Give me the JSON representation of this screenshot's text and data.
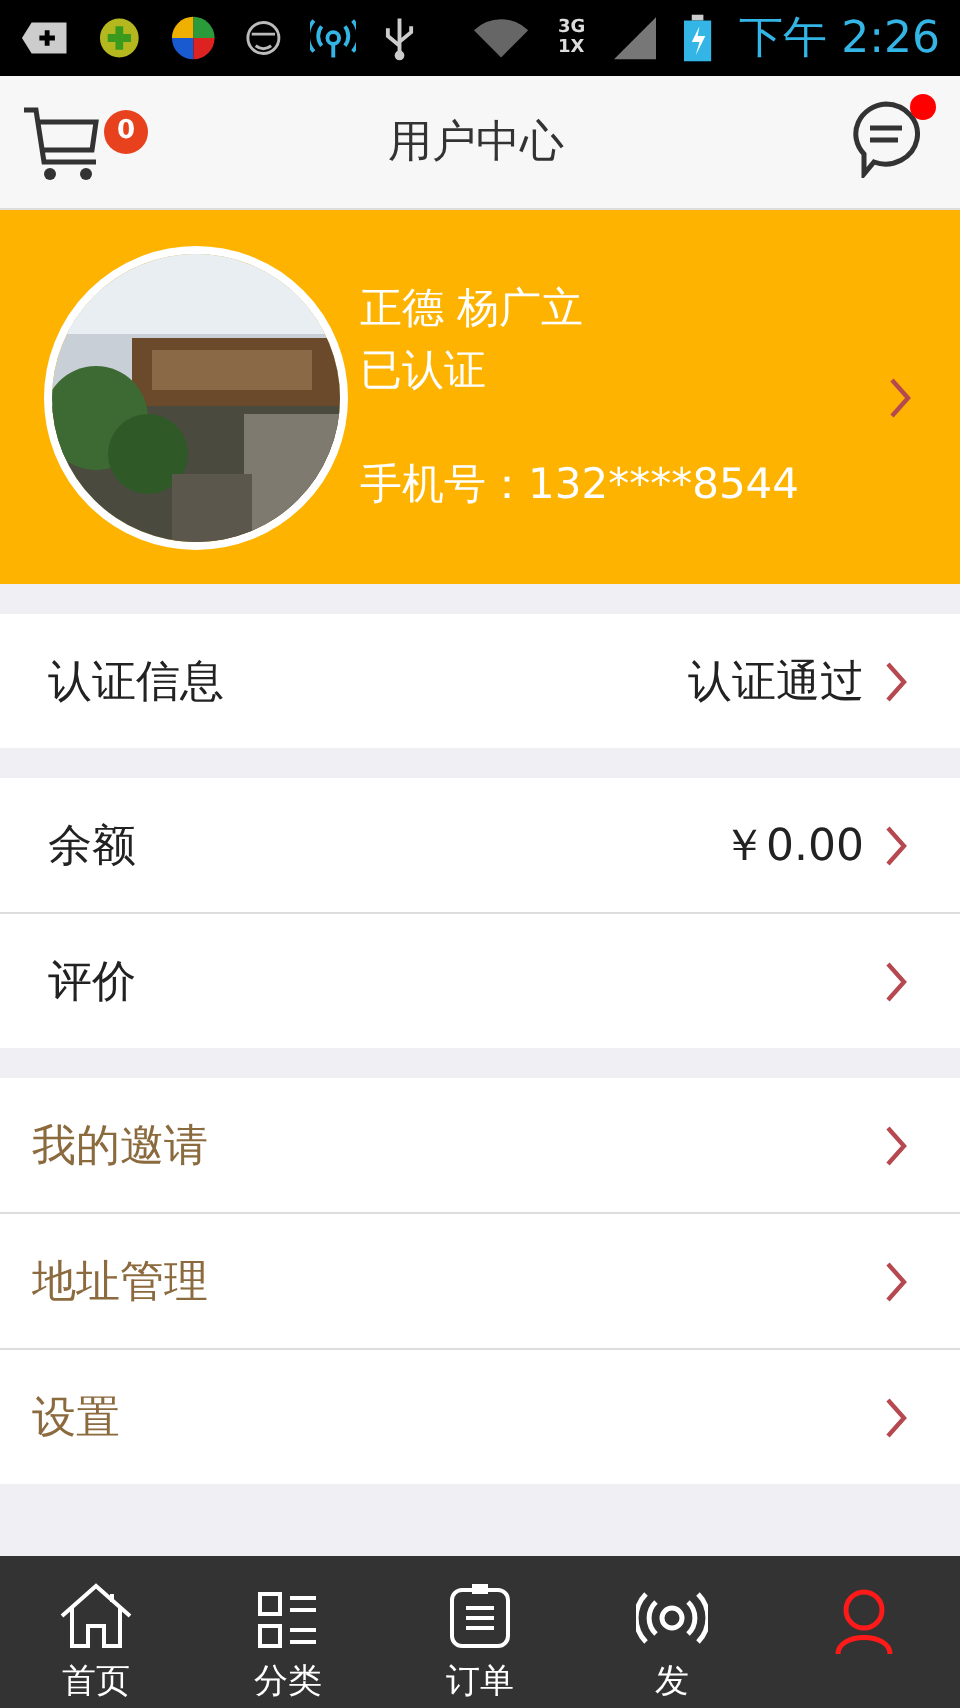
{
  "status_bar": {
    "network_top": "3G",
    "network_bottom": "1X",
    "time": "下午 2:26"
  },
  "header": {
    "title": "用户中心",
    "cart_badge": "0",
    "messages_unread": true
  },
  "profile": {
    "name": "正德 杨广立",
    "status": "已认证",
    "phone": "手机号：132****8544"
  },
  "groups": [
    {
      "items": [
        {
          "kind": "plain",
          "label": "认证信息",
          "value": "认证通过"
        }
      ]
    },
    {
      "items": [
        {
          "kind": "plain",
          "label": "余额",
          "value": "￥0.00"
        },
        {
          "kind": "plain",
          "label": "评价"
        }
      ]
    },
    {
      "items": [
        {
          "kind": "accent",
          "label": "我的邀请"
        },
        {
          "kind": "accent",
          "label": "地址管理"
        },
        {
          "kind": "accent",
          "label": "设置"
        }
      ]
    }
  ],
  "tabs": [
    {
      "kind": "home",
      "label": "首页",
      "selected": false
    },
    {
      "kind": "category",
      "label": "分类",
      "selected": false
    },
    {
      "kind": "order",
      "label": "订单",
      "selected": false
    },
    {
      "kind": "broadcast",
      "label": "发",
      "selected": false
    },
    {
      "kind": "user",
      "selected": true
    }
  ]
}
